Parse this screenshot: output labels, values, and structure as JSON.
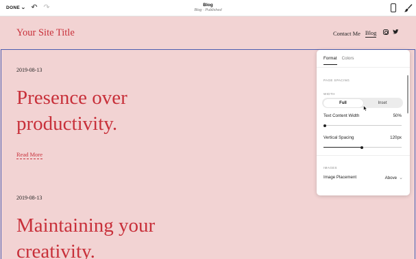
{
  "toolbar": {
    "done_label": "DONE",
    "page_title": "Blog",
    "page_status": "Blog · Published",
    "icons": [
      "chevron-down-icon",
      "undo-icon",
      "redo-icon",
      "mobile-icon",
      "paintbrush-icon"
    ]
  },
  "site": {
    "title": "Your Site Title",
    "nav": {
      "contact": "Contact Me",
      "blog": "Blog"
    },
    "social_icons": [
      "instagram-icon",
      "twitter-icon"
    ],
    "accent_color": "#c8303a",
    "background_color": "#f2d3d3"
  },
  "posts": [
    {
      "date": "2019-08-13",
      "title": "Presence over productivity.",
      "read_more": "Read More"
    },
    {
      "date": "2019-08-13",
      "title": "Maintaining your creativity."
    }
  ],
  "panel": {
    "tabs": {
      "format": "Format",
      "colors": "Colors",
      "active": "Format"
    },
    "page_spacing_label": "PAGE SPACING",
    "width_label": "WIDTH",
    "width_options": {
      "full": "Full",
      "inset": "Inset",
      "selected": "Full"
    },
    "text_content_width": {
      "label": "Text Content Width",
      "value": "50%",
      "level": 0.0
    },
    "vertical_spacing": {
      "label": "Vertical Spacing",
      "value": "120px",
      "level": 0.49
    },
    "images_label": "IMAGES",
    "image_placement": {
      "label": "Image Placement",
      "value": "Above"
    }
  }
}
